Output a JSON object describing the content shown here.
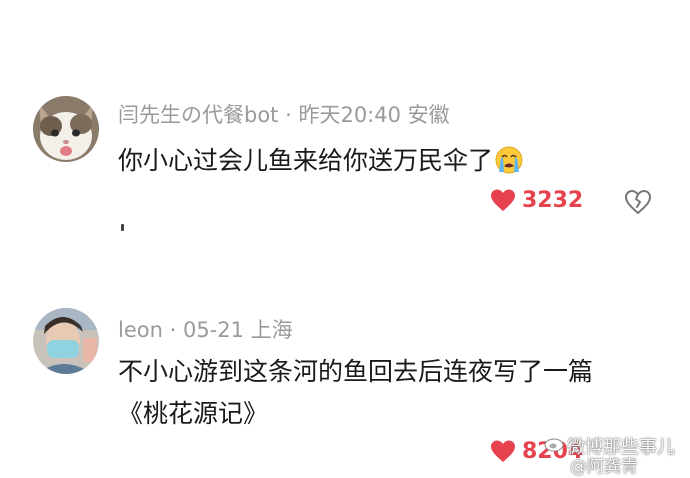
{
  "comments": [
    {
      "author": "闫先生の代餐bot",
      "time": "昨天20:40",
      "location": "安徽",
      "text": "你小心过会儿鱼来给你送万民伞了",
      "emoji": "loudly-crying-face",
      "likes": "3232"
    },
    {
      "author": "leon",
      "time": "05-21",
      "location": "上海",
      "text": "不小心游到这条河的鱼回去后连夜写了一篇《桃花源记》",
      "likes": "8204"
    }
  ],
  "separator": " · ",
  "watermark": {
    "line1": "微博那些事儿",
    "line2": "@阿龚青"
  },
  "colors": {
    "like": "#e5424d",
    "meta": "#9a9a9a",
    "text": "#1a1a1a"
  }
}
